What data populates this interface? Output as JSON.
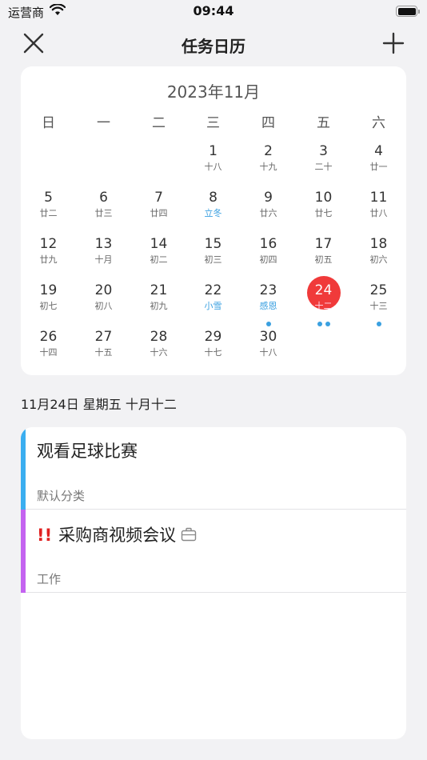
{
  "status": {
    "carrier": "运营商",
    "time": "09:44"
  },
  "nav": {
    "title": "任务日历",
    "close_icon": "close-icon",
    "add_icon": "plus-icon"
  },
  "calendar": {
    "month_title": "2023年11月",
    "weekdays": [
      "日",
      "一",
      "二",
      "三",
      "四",
      "五",
      "六"
    ],
    "selected_day": 24,
    "selected_color": "#f03a3a",
    "term_color": "#3aa0e0",
    "days": [
      {
        "d": "1",
        "l": "十八",
        "col": 3,
        "row": 0
      },
      {
        "d": "2",
        "l": "十九",
        "col": 4,
        "row": 0
      },
      {
        "d": "3",
        "l": "二十",
        "col": 5,
        "row": 0
      },
      {
        "d": "4",
        "l": "廿一",
        "col": 6,
        "row": 0
      },
      {
        "d": "5",
        "l": "廿二",
        "col": 0,
        "row": 1
      },
      {
        "d": "6",
        "l": "廿三",
        "col": 1,
        "row": 1
      },
      {
        "d": "7",
        "l": "廿四",
        "col": 2,
        "row": 1
      },
      {
        "d": "8",
        "l": "立冬",
        "col": 3,
        "row": 1,
        "term": true
      },
      {
        "d": "9",
        "l": "廿六",
        "col": 4,
        "row": 1
      },
      {
        "d": "10",
        "l": "廿七",
        "col": 5,
        "row": 1
      },
      {
        "d": "11",
        "l": "廿八",
        "col": 6,
        "row": 1
      },
      {
        "d": "12",
        "l": "廿九",
        "col": 0,
        "row": 2
      },
      {
        "d": "13",
        "l": "十月",
        "col": 1,
        "row": 2
      },
      {
        "d": "14",
        "l": "初二",
        "col": 2,
        "row": 2
      },
      {
        "d": "15",
        "l": "初三",
        "col": 3,
        "row": 2
      },
      {
        "d": "16",
        "l": "初四",
        "col": 4,
        "row": 2
      },
      {
        "d": "17",
        "l": "初五",
        "col": 5,
        "row": 2
      },
      {
        "d": "18",
        "l": "初六",
        "col": 6,
        "row": 2
      },
      {
        "d": "19",
        "l": "初七",
        "col": 0,
        "row": 3
      },
      {
        "d": "20",
        "l": "初八",
        "col": 1,
        "row": 3
      },
      {
        "d": "21",
        "l": "初九",
        "col": 2,
        "row": 3
      },
      {
        "d": "22",
        "l": "小雪",
        "col": 3,
        "row": 3,
        "term": true
      },
      {
        "d": "23",
        "l": "感恩",
        "col": 4,
        "row": 3,
        "term": true,
        "dots": 1
      },
      {
        "d": "24",
        "l": "十二",
        "col": 5,
        "row": 3,
        "selected": true,
        "dots": 2
      },
      {
        "d": "25",
        "l": "十三",
        "col": 6,
        "row": 3,
        "dots": 1
      },
      {
        "d": "26",
        "l": "十四",
        "col": 0,
        "row": 4
      },
      {
        "d": "27",
        "l": "十五",
        "col": 1,
        "row": 4
      },
      {
        "d": "28",
        "l": "十六",
        "col": 2,
        "row": 4
      },
      {
        "d": "29",
        "l": "十七",
        "col": 3,
        "row": 4
      },
      {
        "d": "30",
        "l": "十八",
        "col": 4,
        "row": 4
      }
    ]
  },
  "date_header": "11月24日 星期五 十月十二",
  "tasks": [
    {
      "title": "观看足球比赛",
      "category": "默认分类",
      "color": "#3aaef0",
      "priority": "",
      "icon": ""
    },
    {
      "title": "采购商视频会议",
      "category": "工作",
      "color": "#c463f0",
      "priority": "!!",
      "icon": "briefcase-icon"
    }
  ]
}
